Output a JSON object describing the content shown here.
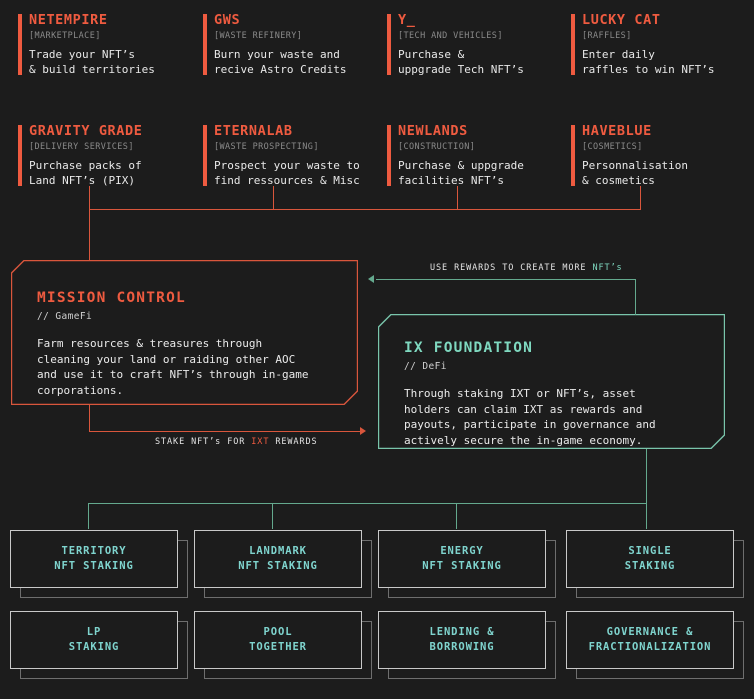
{
  "ecosystem": {
    "row1": [
      {
        "title": "NETEMPIRE",
        "tag": "[MARKETPLACE]",
        "desc": "Trade your NFT’s\n& build territories"
      },
      {
        "title": "GWS",
        "tag": "[WASTE REFINERY]",
        "desc": "Burn your waste and\nrecive Astro Credits"
      },
      {
        "title": "Y_",
        "tag": "[TECH AND VEHICLES]",
        "desc": "Purchase &\nuppgrade Tech NFT’s"
      },
      {
        "title": "LUCKY CAT",
        "tag": "[RAFFLES]",
        "desc": "Enter daily\nraffles to win NFT’s"
      }
    ],
    "row2": [
      {
        "title": "GRAVITY GRADE",
        "tag": "[DELIVERY SERVICES]",
        "desc": "Purchase packs of\nLand NFT’s (PIX)"
      },
      {
        "title": "ETERNALAB",
        "tag": "[WASTE PROSPECTING]",
        "desc": "Prospect your waste to\nfind ressources & Misc"
      },
      {
        "title": "NEWLANDS",
        "tag": "[CONSTRUCTION]",
        "desc": "Purchase & uppgrade\nfacilities NFT’s"
      },
      {
        "title": "HAVEBLUE",
        "tag": "[COSMETICS]",
        "desc": "Personnalisation\n& cosmetics"
      }
    ]
  },
  "mission": {
    "title": "MISSION CONTROL",
    "subtitle": "// GameFi",
    "desc": "Farm resources & treasures through\ncleaning your land or raiding other AOC\nand use it to craft NFT’s through in-game\ncorporations."
  },
  "foundation": {
    "title": "IX FOUNDATION",
    "subtitle": "// DeFi",
    "desc": "Through staking IXT or NFT’s, asset\nholders can claim IXT as rewards and\npayouts, participate in governance and\nactively secure the in-game economy."
  },
  "connectors": {
    "rewards": {
      "prefix": "USE REWARDS TO CREATE MORE ",
      "highlight": "NFT’s"
    },
    "stake": {
      "prefix": "STAKE NFT’s FOR ",
      "highlight": "IXT",
      "suffix": " REWARDS"
    }
  },
  "staking_cards": [
    {
      "line1": "TERRITORY",
      "line2": "NFT STAKING"
    },
    {
      "line1": "LANDMARK",
      "line2": "NFT STAKING"
    },
    {
      "line1": "ENERGY",
      "line2": "NFT STAKING"
    },
    {
      "line1": "SINGLE",
      "line2": "STAKING"
    },
    {
      "line1": "LP",
      "line2": "STAKING"
    },
    {
      "line1": "POOL",
      "line2": "TOGETHER"
    },
    {
      "line1": "LENDING &",
      "line2": "BORROWING"
    },
    {
      "line1": "GOVERNANCE &",
      "line2": "FRACTIONALIZATION"
    }
  ],
  "colors": {
    "background": "#1c1c1c",
    "accent_orange": "#ef5b40",
    "accent_teal": "#7fd9c0",
    "card_teal": "#7fd4ce",
    "line_orange": "#d9563c",
    "line_teal": "#64a98e",
    "muted": "#8a8a8a"
  }
}
